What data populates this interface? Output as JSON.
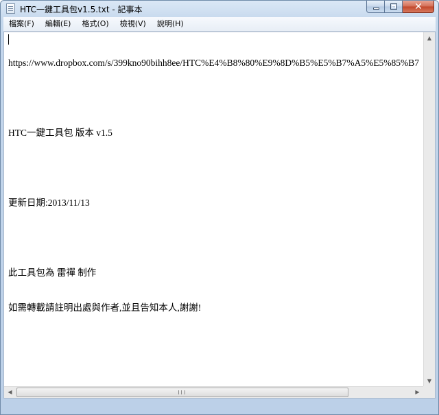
{
  "window": {
    "title": "HTC一鍵工具包v1.5.txt - 記事本"
  },
  "menu": {
    "items": [
      {
        "label": "檔案(F)"
      },
      {
        "label": "編輯(E)"
      },
      {
        "label": "格式(O)"
      },
      {
        "label": "檢視(V)"
      },
      {
        "label": "說明(H)"
      }
    ]
  },
  "document": {
    "lines": [
      "https://www.dropbox.com/s/399kno90bihh8ee/HTC%E4%B8%80%E9%8D%B5%E5%B7%A5%E5%85%B7",
      "",
      "HTC一鍵工具包 版本 v1.5",
      "",
      "更新日期:2013/11/13",
      "",
      "此工具包為 雷禪 制作",
      "如需轉載請註明出處與作者,並且告知本人,謝謝!"
    ]
  },
  "icons": {
    "app": "notepad-icon",
    "minimize": "minimize-icon",
    "maximize": "maximize-icon",
    "close": "close-icon"
  }
}
